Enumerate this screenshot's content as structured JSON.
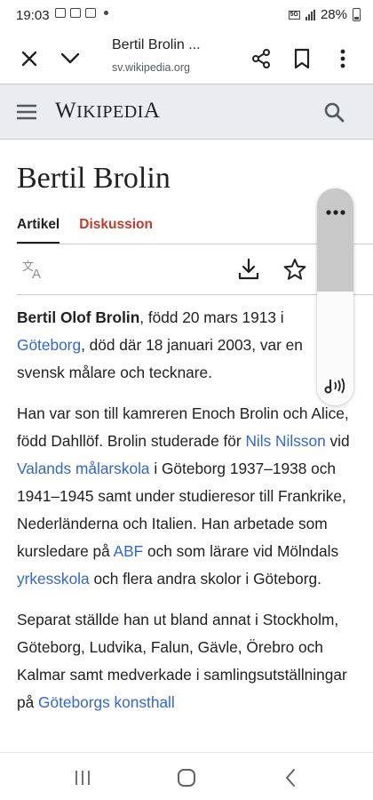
{
  "status": {
    "time": "19:03",
    "network": "5G",
    "battery": "28%"
  },
  "toolbar": {
    "title": "Bertil Brolin ...",
    "url": "sv.wikipedia.org"
  },
  "wiki": {
    "wordmark_first": "W",
    "wordmark_rest": "IKIPEDI",
    "wordmark_last": "A"
  },
  "article": {
    "title": "Bertil Brolin",
    "tabs": [
      "Artikel",
      "Diskussion"
    ],
    "p1": {
      "name": "Bertil Olof Brolin",
      "t1": ", född 20 mars 1913 i ",
      "link1": "Göteborg",
      "t2": ", död där 18 januari 2003, var en svensk målare och tecknare."
    },
    "p2": {
      "t1": "Han var son till kamreren Enoch Brolin och Alice, född Dahllöf. Brolin studerade för ",
      "link1": "Nils Nilsson",
      "t2": " vid ",
      "link2": "Valands målarskola",
      "t3": " i Göteborg 1937–1938 och 1941–1945 samt under studieresor till Frankrike, Nederländerna och Italien. Han arbetade som kursledare på ",
      "link3": "ABF",
      "t4": " och som lärare vid Mölndals ",
      "link4": "yrkesskola",
      "t5": " och flera andra skolor i Göteborg."
    },
    "p3": {
      "t1": "Separat ställde han ut bland annat i Stockholm, Göteborg, Ludvika, Falun, Gävle, Örebro och Kalmar samt medverkade i samlingsutställningar på ",
      "link1": "Göteborgs konsthall"
    }
  }
}
